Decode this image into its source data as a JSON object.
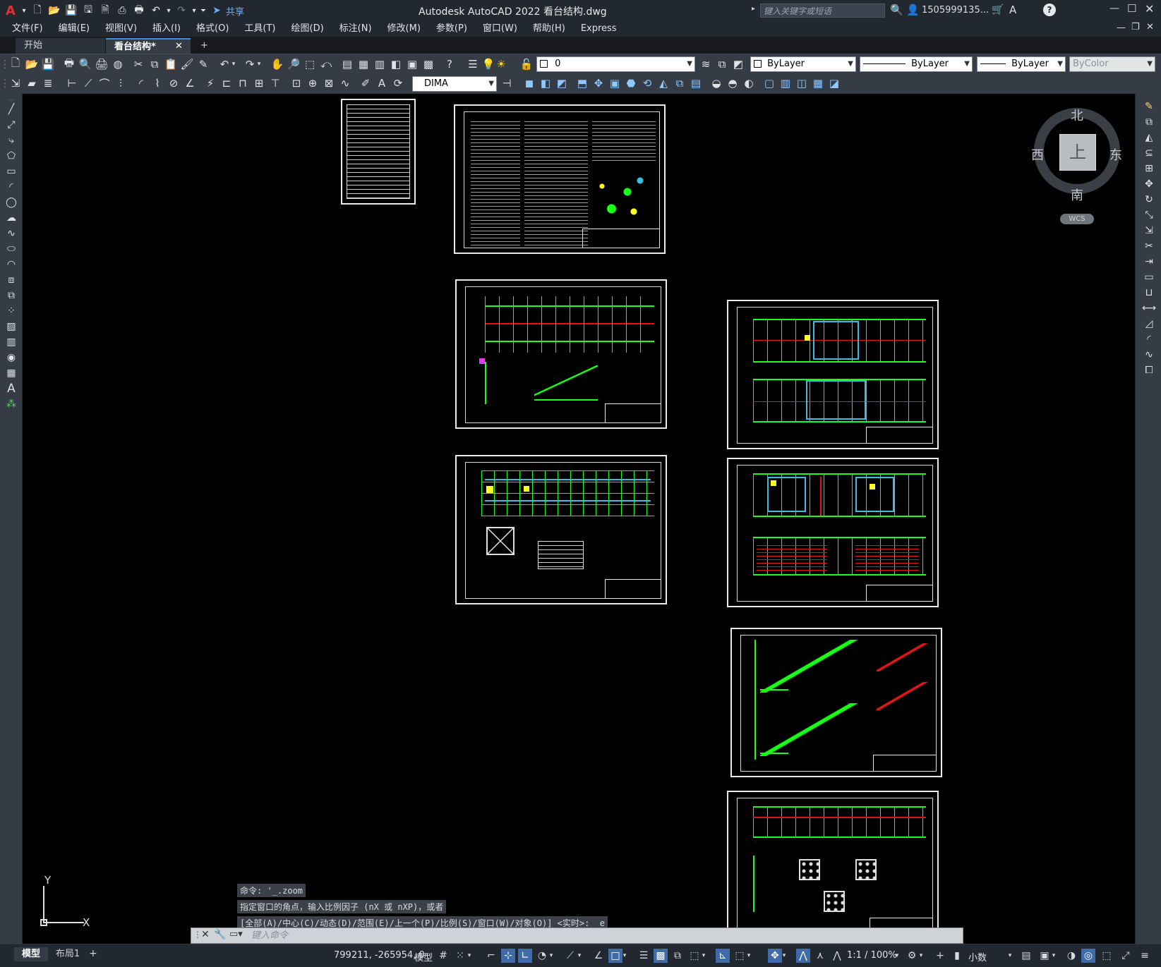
{
  "titlebar": {
    "app_logo": "A",
    "share_label": "共享",
    "title": "Autodesk AutoCAD 2022    看台结构.dwg",
    "search_placeholder": "键入关键字或短语",
    "user": "1505999135...",
    "icons": [
      "new-icon",
      "open-icon",
      "save-icon",
      "save-as-icon",
      "publish-icon",
      "plot-icon",
      "undo-icon",
      "redo-icon"
    ]
  },
  "menubar": {
    "items": [
      "文件(F)",
      "编辑(E)",
      "视图(V)",
      "插入(I)",
      "格式(O)",
      "工具(T)",
      "绘图(D)",
      "标注(N)",
      "修改(M)",
      "参数(P)",
      "窗口(W)",
      "帮助(H)",
      "Express"
    ]
  },
  "tabs": [
    {
      "label": "开始",
      "active": false
    },
    {
      "label": "看台结构*",
      "active": true
    }
  ],
  "properties": {
    "layer": "0",
    "color": "ByLayer",
    "linetype": "ByLayer",
    "lineweight": "ByLayer",
    "plotstyle": "ByColor",
    "dimstyle": "DIMA"
  },
  "viewcube": {
    "north": "北",
    "south": "南",
    "east": "东",
    "west": "西",
    "face": "上",
    "wcs": "WCS"
  },
  "ucs": {
    "x": "X",
    "y": "Y"
  },
  "command": {
    "history": [
      "命令: '_.zoom",
      "指定窗口的角点，输入比例因子 (nX 或 nXP)，或者",
      "[全部(A)/中心(C)/动态(D)/范围(E)/上一个(P)/比例(S)/窗口(W)/对象(O)] <实时>: _e"
    ],
    "placeholder": "键入命令"
  },
  "statusbar": {
    "tab_model": "模型",
    "tab_layout": "布局1",
    "coords": "799211, -265954, 0",
    "space": "模型",
    "scale": "1:1 / 100%",
    "units": "小数"
  },
  "colors": {
    "bg": "#000000",
    "ui_dark": "#212830",
    "toolbar": "#353c46",
    "accent": "#3f6ca8",
    "line_green": "#19ff19",
    "line_red": "#e01515",
    "line_yellow": "#ffff2a",
    "line_cyan": "#3dbbe0"
  }
}
